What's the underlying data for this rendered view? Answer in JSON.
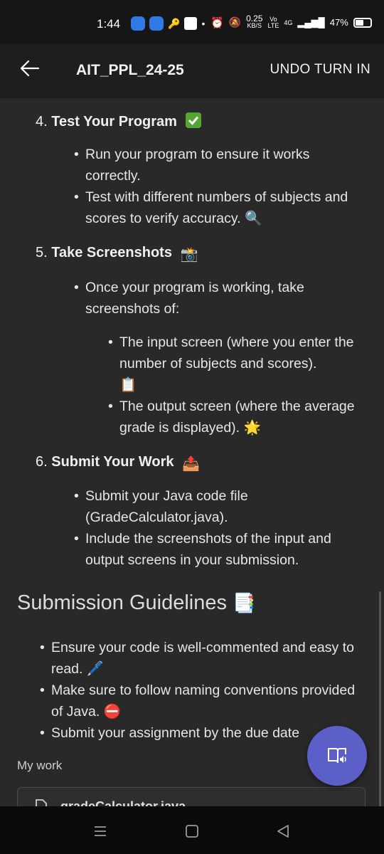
{
  "status_bar": {
    "time": "1:44",
    "net_speed_top": "0.25",
    "net_speed_bottom": "KB/S",
    "volte_top": "Vo",
    "volte_bottom": "LTE",
    "network": "4G",
    "battery": "47%"
  },
  "app_bar": {
    "title": "AIT_PPL_24-25",
    "undo_label": "UNDO TURN IN"
  },
  "steps": [
    {
      "number": "4.",
      "title": "Test Your Program",
      "emoji": "check-mark-icon",
      "bullets": [
        "Run your program to ensure it works correctly.",
        "Test with different numbers of subjects and scores to verify accuracy."
      ]
    },
    {
      "number": "5.",
      "title": "Take Screenshots",
      "emoji": "camera-flash-icon",
      "bullets": [
        "Once your program is working, take screenshots of:"
      ],
      "sub_bullets": [
        "The input screen (where you enter the number of subjects and scores).",
        "The output screen (where the average grade is displayed)."
      ]
    },
    {
      "number": "6.",
      "title": "Submit Your Work",
      "emoji": "outbox-tray-icon",
      "bullets": [
        "Submit your Java code file (GradeCalculator.java).",
        "Include the screenshots of the input and output screens in your submission."
      ]
    }
  ],
  "guidelines": {
    "heading": "Submission Guidelines",
    "items": [
      "Ensure your code is well-commented and easy to read.",
      "Make sure to follow naming conventions provided of Java.",
      "Submit your assignment by the due date"
    ]
  },
  "my_work": {
    "label": "My work",
    "file_name": "gradeCalculator.java"
  },
  "colors": {
    "background": "#292929",
    "app_bar": "#1e1e1e",
    "fab": "#5b5fc7"
  }
}
